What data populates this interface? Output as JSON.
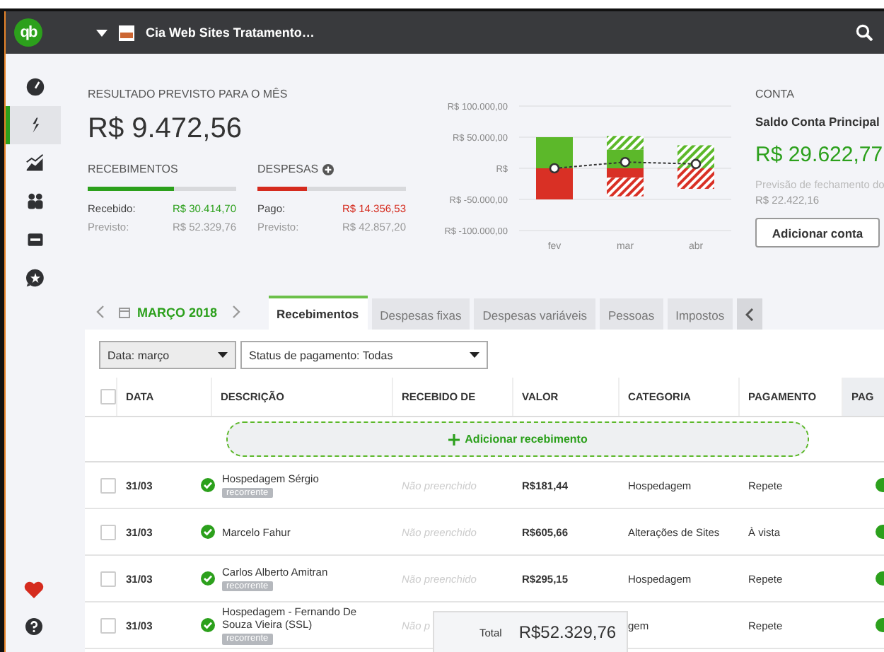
{
  "topbar": {
    "logo": "qb",
    "company": "Cia Web Sites Tratamento…"
  },
  "sidebar": {
    "items": [
      {
        "selected": false
      },
      {
        "selected": true
      },
      {
        "selected": false
      },
      {
        "selected": false
      },
      {
        "selected": false
      },
      {
        "selected": false
      }
    ]
  },
  "summary": {
    "title": "RESULTADO PREVISTO PARA O MÊS",
    "amount": "R$ 9.472,56",
    "groups": [
      {
        "kind": "income",
        "label": "RECEBIMENTOS",
        "level": 0.58,
        "rows": [
          {
            "label": "Recebido:",
            "value": "R$ 30.414,70"
          },
          {
            "label": "Previsto:",
            "value": "R$ 52.329,76"
          }
        ]
      },
      {
        "kind": "expense",
        "label": "DESPESAS",
        "level": 0.335,
        "rows": [
          {
            "label": "Pago:",
            "value": "R$ 14.356,53"
          },
          {
            "label": "Previsto:",
            "value": "R$ 42.857,20"
          }
        ]
      }
    ]
  },
  "chart": {
    "chart_data": {
      "type": "bar",
      "stacked": true,
      "categories": [
        "fev",
        "mar",
        "abr"
      ],
      "ylim": [
        -100000,
        100000
      ],
      "yticks": [
        {
          "value": 100000,
          "label": "R$ 100.000,00"
        },
        {
          "value": 50000,
          "label": "R$ 50.000,00"
        },
        {
          "value": 0,
          "label": "R$"
        },
        {
          "value": -50000,
          "label": "R$ -50.000,00"
        },
        {
          "value": -100000,
          "label": "R$ -100.000,00"
        }
      ],
      "grid": true,
      "series": [
        {
          "type": "bar",
          "color": "#5cb82a",
          "values": [
            50000,
            30000,
            0
          ]
        },
        {
          "type": "bar",
          "line_style": "hatched",
          "color": "#5cb82a",
          "values": [
            0,
            22000,
            37000
          ]
        },
        {
          "type": "bar",
          "color": "#d93025",
          "values": [
            -50000,
            -15000,
            0
          ]
        },
        {
          "type": "bar",
          "line_style": "hatched",
          "color": "#d93025",
          "values": [
            0,
            -30000,
            -33000
          ]
        },
        {
          "type": "line",
          "line_style": "dashed",
          "marker": "circle",
          "color": "#333333",
          "values": [
            0,
            10000,
            7000
          ]
        }
      ]
    }
  },
  "account": {
    "title": "CONTA",
    "name": "Saldo Conta Principal",
    "balance": "R$ 29.622,77",
    "forecast_label": "Previsão de fechamento do",
    "forecast_value": "R$ 22.422,16",
    "button": "Adicionar conta"
  },
  "period": {
    "label": "MARÇO 2018"
  },
  "tabs": [
    {
      "label": "Recebimentos",
      "selected": true
    },
    {
      "label": "Despesas fixas",
      "selected": false
    },
    {
      "label": "Despesas variáveis",
      "selected": false
    },
    {
      "label": "Pessoas",
      "selected": false
    },
    {
      "label": "Impostos",
      "selected": false
    }
  ],
  "filters": [
    {
      "value": "Data: março"
    },
    {
      "value": "Status de pagamento: Todas"
    }
  ],
  "table": {
    "columns": [
      "DATA",
      "DESCRIÇÃO",
      "RECEBIDO DE",
      "VALOR",
      "CATEGORIA",
      "PAGAMENTO",
      "PAG"
    ],
    "add_button": "Adicionar recebimento",
    "select_all": {
      "checked": false
    },
    "rows": [
      {
        "checked": false,
        "date": "31/03",
        "confirmed": true,
        "description": "Hospedagem Sérgio",
        "tag": "recorrente",
        "received_from": "Não preenchido",
        "value": "R$181,44",
        "category": "Hospedagem",
        "payment": "Repete",
        "paid": true
      },
      {
        "checked": false,
        "date": "31/03",
        "confirmed": true,
        "description": "Marcelo Fahur",
        "received_from": "Não preenchido",
        "value": "R$605,66",
        "category": "Alterações de Sites",
        "payment": "À vista",
        "paid": true
      },
      {
        "checked": false,
        "date": "31/03",
        "confirmed": true,
        "description": "Carlos Alberto Amitran",
        "tag": "recorrente",
        "received_from": "Não preenchido",
        "value": "R$295,15",
        "category": "Hospedagem",
        "payment": "Repete",
        "paid": true
      },
      {
        "checked": false,
        "date": "31/03",
        "confirmed": true,
        "description": "Hospedagem - Fernando De Souza Vieira (SSL)",
        "tag": "recorrente",
        "received_from": "Não p",
        "category": "gem",
        "payment": "Repete",
        "paid": true
      }
    ]
  },
  "total": {
    "label": "Total",
    "value": "R$52.329,76"
  }
}
